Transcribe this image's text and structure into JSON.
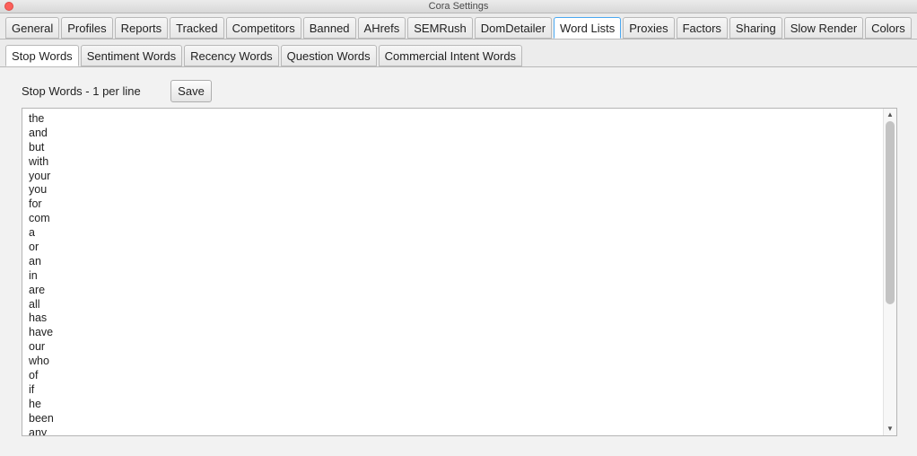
{
  "window": {
    "title": "Cora Settings"
  },
  "top_tabs": [
    {
      "label": "General"
    },
    {
      "label": "Profiles"
    },
    {
      "label": "Reports"
    },
    {
      "label": "Tracked"
    },
    {
      "label": "Competitors"
    },
    {
      "label": "Banned"
    },
    {
      "label": "AHrefs"
    },
    {
      "label": "SEMRush"
    },
    {
      "label": "DomDetailer"
    },
    {
      "label": "Word Lists"
    },
    {
      "label": "Proxies"
    },
    {
      "label": "Factors"
    },
    {
      "label": "Sharing"
    },
    {
      "label": "Slow Render"
    },
    {
      "label": "Colors"
    }
  ],
  "top_tabs_active": "Word Lists",
  "sub_tabs": [
    {
      "label": "Stop Words"
    },
    {
      "label": "Sentiment Words"
    },
    {
      "label": "Recency Words"
    },
    {
      "label": "Question Words"
    },
    {
      "label": "Commercial Intent Words"
    }
  ],
  "sub_tabs_active": "Stop Words",
  "panel": {
    "label": "Stop Words - 1 per line",
    "save_label": "Save",
    "words": [
      "the",
      "and",
      "but",
      "with",
      "your",
      "you",
      "for",
      "com",
      "a",
      "or",
      "an",
      "in",
      "are",
      "all",
      "has",
      "have",
      "our",
      "who",
      "of",
      "if",
      "he",
      "been",
      "any"
    ]
  },
  "colors": {
    "active_tab_border": "#4aa8f0",
    "close_button": "#fc605b"
  }
}
